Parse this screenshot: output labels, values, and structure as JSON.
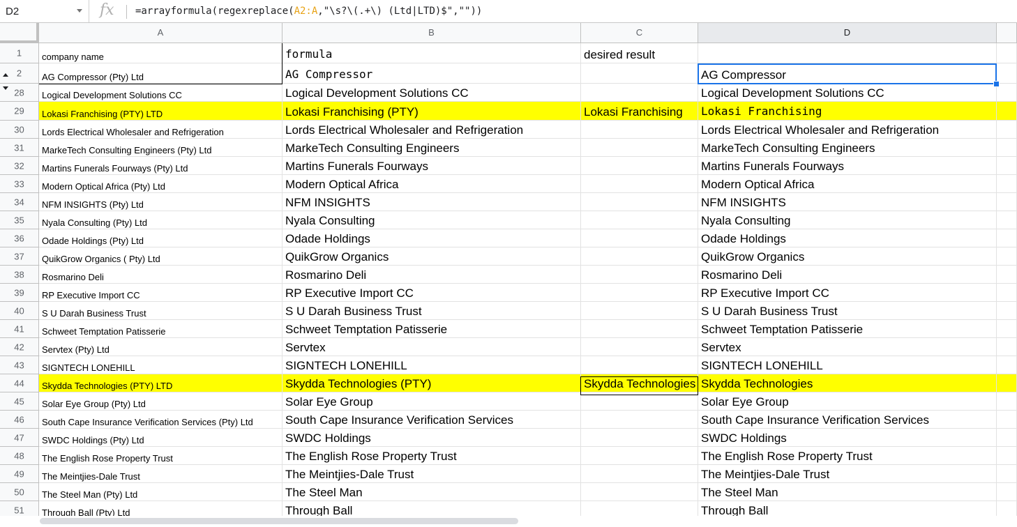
{
  "namebox": {
    "ref": "D2"
  },
  "formula_bar": {
    "fx": "fx",
    "segments": [
      {
        "text": "=arrayformula(regexreplace(",
        "kind": "plain"
      },
      {
        "text": "A2:A",
        "kind": "ref"
      },
      {
        "text": ",\"\\s?\\(.+\\) (Ltd|LTD)$\",\"\"))",
        "kind": "plain"
      }
    ]
  },
  "columns": [
    "A",
    "B",
    "C",
    "D"
  ],
  "rows": [
    {
      "num": "1",
      "a": "company name",
      "b": "formula",
      "c": "desired result",
      "d": "",
      "highlight": false
    },
    {
      "num": "2",
      "a": "AG Compressor (Pty) Ltd",
      "b": "AG Compressor",
      "c": "",
      "d": "AG Compressor",
      "highlight": false,
      "group": "up"
    },
    {
      "num": "28",
      "a": "Logical Development Solutions CC",
      "b": "Logical Development Solutions CC",
      "c": "",
      "d": "Logical Development Solutions CC",
      "highlight": false,
      "group": "down"
    },
    {
      "num": "29",
      "a": "Lokasi Franchising (PTY) LTD",
      "b": "Lokasi Franchising (PTY)",
      "c": "Lokasi Franchising",
      "d": "Lokasi Franchising",
      "highlight": true
    },
    {
      "num": "30",
      "a": "Lords Electrical Wholesaler and Refrigeration",
      "b": "Lords Electrical Wholesaler and Refrigeration",
      "c": "",
      "d": "Lords Electrical Wholesaler and Refrigeration",
      "highlight": false
    },
    {
      "num": "31",
      "a": "MarkeTech Consulting Engineers (Pty) Ltd",
      "b": "MarkeTech Consulting Engineers",
      "c": "",
      "d": "MarkeTech Consulting Engineers",
      "highlight": false
    },
    {
      "num": "32",
      "a": "Martins Funerals Fourways (Pty) Ltd",
      "b": "Martins Funerals Fourways",
      "c": "",
      "d": "Martins Funerals Fourways",
      "highlight": false
    },
    {
      "num": "33",
      "a": "Modern Optical Africa (Pty) Ltd",
      "b": "Modern Optical Africa",
      "c": "",
      "d": "Modern Optical Africa",
      "highlight": false
    },
    {
      "num": "34",
      "a": "NFM INSIGHTS (Pty) Ltd",
      "b": "NFM INSIGHTS",
      "c": "",
      "d": "NFM INSIGHTS",
      "highlight": false
    },
    {
      "num": "35",
      "a": "Nyala Consulting (Pty) Ltd",
      "b": "Nyala Consulting",
      "c": "",
      "d": "Nyala Consulting",
      "highlight": false
    },
    {
      "num": "36",
      "a": "Odade Holdings (Pty) Ltd",
      "b": "Odade Holdings",
      "c": "",
      "d": "Odade Holdings",
      "highlight": false
    },
    {
      "num": "37",
      "a": "QuikGrow Organics ( Pty) Ltd",
      "b": "QuikGrow Organics",
      "c": "",
      "d": "QuikGrow Organics",
      "highlight": false
    },
    {
      "num": "38",
      "a": "Rosmarino Deli",
      "b": "Rosmarino Deli",
      "c": "",
      "d": "Rosmarino Deli",
      "highlight": false
    },
    {
      "num": "39",
      "a": "RP Executive Import CC",
      "b": "RP Executive Import CC",
      "c": "",
      "d": "RP Executive Import CC",
      "highlight": false
    },
    {
      "num": "40",
      "a": "S U Darah Business Trust",
      "b": "S U Darah Business Trust",
      "c": "",
      "d": "S U Darah Business Trust",
      "highlight": false
    },
    {
      "num": "41",
      "a": "Schweet Temptation Patisserie",
      "b": "Schweet Temptation Patisserie",
      "c": "",
      "d": "Schweet Temptation Patisserie",
      "highlight": false
    },
    {
      "num": "42",
      "a": "Servtex (Pty) Ltd",
      "b": "Servtex",
      "c": "",
      "d": "Servtex",
      "highlight": false
    },
    {
      "num": "43",
      "a": "SIGNTECH LONEHILL",
      "b": "SIGNTECH LONEHILL",
      "c": "",
      "d": "SIGNTECH LONEHILL",
      "highlight": false
    },
    {
      "num": "44",
      "a": "Skydda Technologies (PTY) LTD",
      "b": "Skydda Technologies (PTY)",
      "c": "Skydda Technologies",
      "d": "Skydda Technologies",
      "highlight": true
    },
    {
      "num": "45",
      "a": "Solar Eye Group (Pty) Ltd",
      "b": "Solar Eye Group",
      "c": "",
      "d": "Solar Eye Group",
      "highlight": false
    },
    {
      "num": "46",
      "a": "South Cape Insurance Verification Services (Pty) Ltd",
      "b": "South Cape Insurance Verification Services",
      "c": "",
      "d": "South Cape Insurance Verification Services",
      "highlight": false
    },
    {
      "num": "47",
      "a": "SWDC Holdings (Pty) Ltd",
      "b": "SWDC Holdings",
      "c": "",
      "d": "SWDC Holdings",
      "highlight": false
    },
    {
      "num": "48",
      "a": "The English Rose Property Trust",
      "b": "The English Rose Property Trust",
      "c": "",
      "d": "The English Rose Property Trust",
      "highlight": false
    },
    {
      "num": "49",
      "a": "The Meintjies-Dale Trust",
      "b": "The Meintjies-Dale Trust",
      "c": "",
      "d": "The Meintjies-Dale Trust",
      "highlight": false
    },
    {
      "num": "50",
      "a": "The Steel Man (Pty) Ltd",
      "b": "The Steel Man",
      "c": "",
      "d": "The Steel Man",
      "highlight": false
    },
    {
      "num": "51",
      "a": "Through Ball (Pty) Ltd",
      "b": "Through Ball",
      "c": "",
      "d": "Through Ball",
      "highlight": false
    }
  ],
  "colors": {
    "highlight": "#ffff00",
    "selection": "#1a73e8",
    "formula_ref": "#e8a317"
  }
}
